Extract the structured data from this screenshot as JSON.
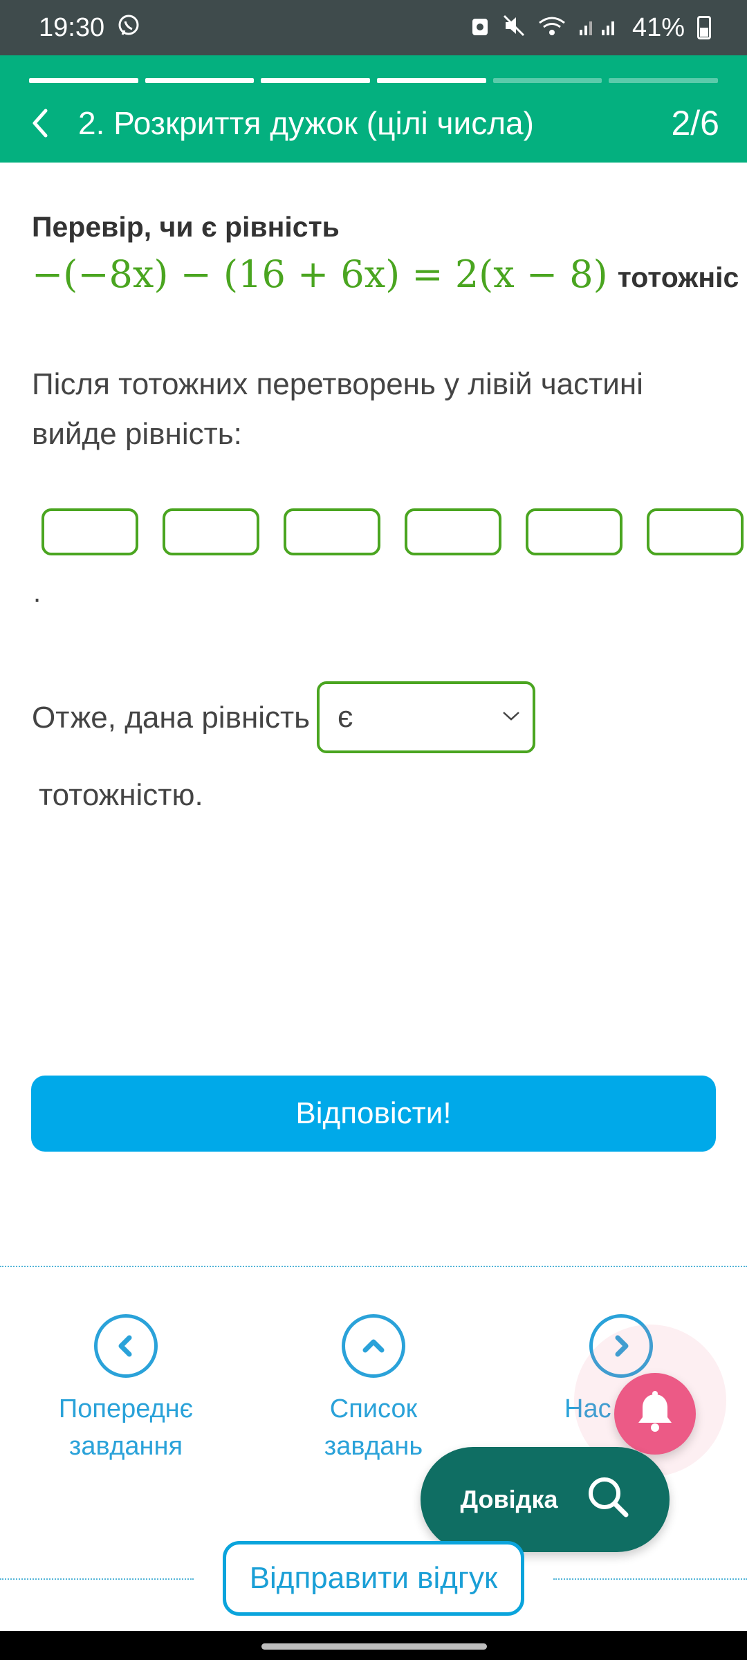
{
  "status_bar": {
    "time": "19:30",
    "battery": "41%",
    "icons": [
      "viber-icon",
      "recycle-icon",
      "mute-icon",
      "wifi-icon",
      "signal-icon",
      "battery-icon"
    ]
  },
  "header": {
    "title": "2. Розкриття дужок (цілі числа)",
    "counter": "2/6",
    "progress": {
      "total": 6,
      "completed": 4
    },
    "color": "#04b07f"
  },
  "question": {
    "title": "Перевір, чи є рівність",
    "equation": "−(−8x) − (16 + 6x) = 2(x − 8)",
    "equation_suffix": "тотожніс",
    "paragraph": "Після тотожних перетворень у лівій частині вийде рівність:",
    "answer_boxes": [
      "",
      "",
      "",
      "",
      "",
      ""
    ],
    "period": ".",
    "conclusion_prefix": "Отже, дана рівність",
    "select_value": "є",
    "conclusion_suffix": "тотожністю."
  },
  "submit": {
    "label": "Відповісти!",
    "color": "#00a9e9"
  },
  "bottom_nav": {
    "prev_label": "Попереднє завдання",
    "list_label": "Список завдань",
    "next_label": "Нас"
  },
  "help": {
    "label": "Довідка",
    "color": "#0f6e63"
  },
  "feedback": {
    "label": "Відправити відгук"
  }
}
